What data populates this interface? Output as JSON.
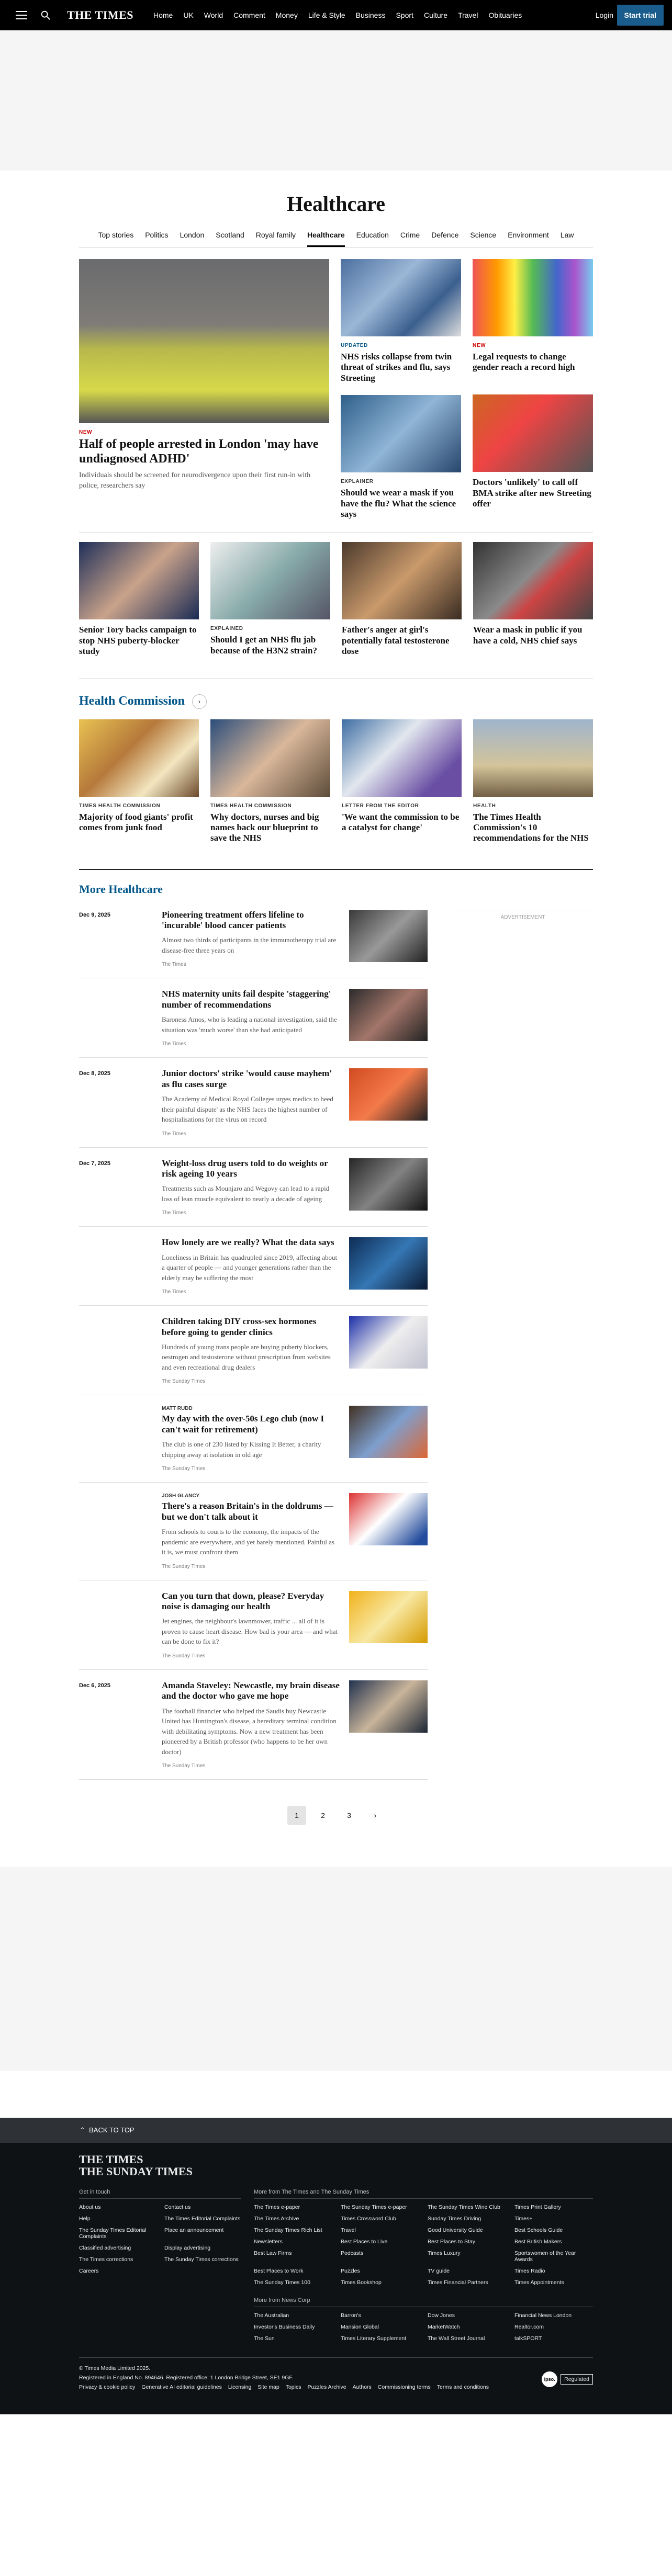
{
  "nav": {
    "logo": "THE TIMES",
    "links": [
      "Home",
      "UK",
      "World",
      "Comment",
      "Money",
      "Life & Style",
      "Business",
      "Sport",
      "Culture",
      "Travel",
      "Obituaries"
    ],
    "login": "Login",
    "start_trial": "Start trial"
  },
  "page": {
    "title": "Healthcare",
    "subnav": [
      "Top stories",
      "Politics",
      "London",
      "Scotland",
      "Royal family",
      "Healthcare",
      "Education",
      "Crime",
      "Defence",
      "Science",
      "Environment",
      "Law"
    ],
    "active_subnav": "Healthcare"
  },
  "lead": {
    "kicker": "NEW",
    "title": "Half of people arrested in London 'may have undiagnosed ADHD'",
    "summary": "Individuals should be screened for neurodivergence upon their first run-in with police, researchers say"
  },
  "top_cards": [
    {
      "kicker": "UPDATED",
      "title": "NHS risks collapse from twin threat of strikes and flu, says Streeting"
    },
    {
      "kicker": "NEW",
      "title": "Legal requests to change gender reach a record high"
    },
    {
      "kicker": "EXPLAINER",
      "title": "Should we wear a mask if you have the flu? What the science says"
    },
    {
      "kicker": "",
      "title": "Doctors 'unlikely' to call off BMA strike after new Streeting offer"
    }
  ],
  "row_cards": [
    {
      "kicker": "",
      "title": "Senior Tory backs campaign to stop NHS puberty-blocker study"
    },
    {
      "kicker": "EXPLAINED",
      "title": "Should I get an NHS flu jab because of the H3N2 strain?"
    },
    {
      "kicker": "",
      "title": "Father's anger at girl's potentially fatal testosterone dose"
    },
    {
      "kicker": "",
      "title": "Wear a mask in public if you have a cold, NHS chief says"
    }
  ],
  "health_commission": {
    "title": "Health Commission",
    "cards": [
      {
        "kicker": "TIMES HEALTH COMMISSION",
        "title": "Majority of food giants' profit comes from junk food"
      },
      {
        "kicker": "TIMES HEALTH COMMISSION",
        "title": "Why doctors, nurses and big names back our blueprint to save the NHS"
      },
      {
        "kicker": "LETTER FROM THE EDITOR",
        "title": "'We want the commission to be a catalyst for change'"
      },
      {
        "kicker": "HEALTH",
        "title": "The Times Health Commission's 10 recommendations for the NHS"
      }
    ]
  },
  "more": {
    "title": "More Healthcare",
    "advertisement": "ADVERTISEMENT",
    "items": [
      {
        "date": "Dec 9, 2025",
        "kicker": "",
        "title": "Pioneering treatment offers lifeline to 'incurable' blood cancer patients",
        "summary": "Almost two thirds of participants in the immunotherapy trial are disease-free three years on",
        "source": "The Times"
      },
      {
        "date": "",
        "kicker": "",
        "title": "NHS maternity units fail despite 'staggering' number of recommendations",
        "summary": "Baroness Amos, who is leading a national investigation, said the situation was 'much worse' than she had anticipated",
        "source": "The Times"
      },
      {
        "date": "Dec 8, 2025",
        "kicker": "",
        "title": "Junior doctors' strike 'would cause mayhem' as flu cases surge",
        "summary": "The Academy of Medical Royal Colleges urges medics to heed their painful dispute' as the NHS faces the highest number of hospitalisations for the virus on record",
        "source": "The Times"
      },
      {
        "date": "Dec 7, 2025",
        "kicker": "",
        "title": "Weight-loss drug users told to do weights or risk ageing 10 years",
        "summary": "Treatments such as Mounjaro and Wegovy can lead to a rapid loss of lean muscle equivalent to nearly a decade of ageing",
        "source": "The Times"
      },
      {
        "date": "",
        "kicker": "",
        "title": "How lonely are we really? What the data says",
        "summary": "Loneliness in Britain has quadrupled since 2019, affecting about a quarter of people — and younger generations rather than the elderly may be suffering the most",
        "source": "The Times"
      },
      {
        "date": "",
        "kicker": "",
        "title": "Children taking DIY cross-sex hormones before going to gender clinics",
        "summary": "Hundreds of young trans people are buying puberty blockers, oestrogen and testosterone without prescription from websites and even recreational drug dealers",
        "source": "The Sunday Times"
      },
      {
        "date": "",
        "kicker": "MATT RUDD",
        "title": "My day with the over-50s Lego club (now I can't wait for retirement)",
        "summary": "The club is one of 230 listed by Kissing It Better, a charity chipping away at isolation in old age",
        "source": "The Sunday Times"
      },
      {
        "date": "",
        "kicker": "JOSH GLANCY",
        "title": "There's a reason Britain's in the doldrums — but we don't talk about it",
        "summary": "From schools to courts to the economy, the impacts of the pandemic are everywhere, and yet barely mentioned. Painful as it is, we must confront them",
        "source": "The Sunday Times"
      },
      {
        "date": "",
        "kicker": "",
        "title": "Can you turn that down, please? Everyday noise is damaging our health",
        "summary": "Jet engines, the neighbour's lawnmower, traffic ... all of it is proven to cause heart disease. How bad is your area — and what can be done to fix it?",
        "source": "The Sunday Times"
      },
      {
        "date": "Dec 6, 2025",
        "kicker": "",
        "title": "Amanda Staveley: Newcastle, my brain disease and the doctor who gave me hope",
        "summary": "The football financier who helped the Saudis buy Newcastle United has Huntington's disease, a hereditary terminal condition with debilitating symptoms. Now a new treatment has been pioneered by a British professor (who happens to be her own doctor)",
        "source": "The Sunday Times"
      }
    ],
    "pages": [
      "1",
      "2",
      "3"
    ],
    "next": "›"
  },
  "footer": {
    "back_to_top": "BACK TO TOP",
    "logo_line1": "THE TIMES",
    "logo_line2": "THE SUNDAY TIMES",
    "get_in_touch_title": "Get in touch",
    "get_in_touch": [
      "About us",
      "Contact us",
      "Help",
      "The Times Editorial Complaints",
      "The Sunday Times Editorial Complaints",
      "Place an announcement",
      "Classified advertising",
      "Display advertising",
      "The Times corrections",
      "The Sunday Times corrections",
      "Careers"
    ],
    "more_from_title": "More from The Times and The Sunday Times",
    "more_from": [
      "The Times e-paper",
      "The Sunday Times e-paper",
      "The Sunday Times Wine Club",
      "Times Print Gallery",
      "The Times Archive",
      "Times Crossword Club",
      "Sunday Times Driving",
      "Times+",
      "The Sunday Times Rich List",
      "Travel",
      "Good University Guide",
      "Best Schools Guide",
      "Newsletters",
      "Best Places to Live",
      "Best Places to Stay",
      "Best British Makers",
      "Best Law Firms",
      "Podcasts",
      "Times Luxury",
      "Sportswomen of the Year Awards",
      "Best Places to Work",
      "Puzzles",
      "TV guide",
      "Times Radio",
      "The Sunday Times 100",
      "Times Bookshop",
      "Times Financial Partners",
      "Times Appointments"
    ],
    "news_corp_title": "More from News Corp",
    "news_corp": [
      "The Australian",
      "Barron's",
      "Dow Jones",
      "Financial News London",
      "Investor's Business Daily",
      "Mansion Global",
      "MarketWatch",
      "Realtor.com",
      "The Sun",
      "Times Literary Supplement",
      "The Wall Street Journal",
      "talkSPORT"
    ],
    "copyright": "© Times Media Limited 2025.",
    "registered": "Registered in England No. 894646. Registered office: 1 London Bridge Street, SE1 9GF.",
    "legal_links": [
      "Privacy & cookie policy",
      "Generative AI editorial guidelines",
      "Licensing",
      "Site map",
      "Topics",
      "Puzzles Archive",
      "Authors",
      "Commissioning terms",
      "Terms and conditions"
    ],
    "ipso": "ipso.",
    "ipso_label": "Regulated"
  }
}
